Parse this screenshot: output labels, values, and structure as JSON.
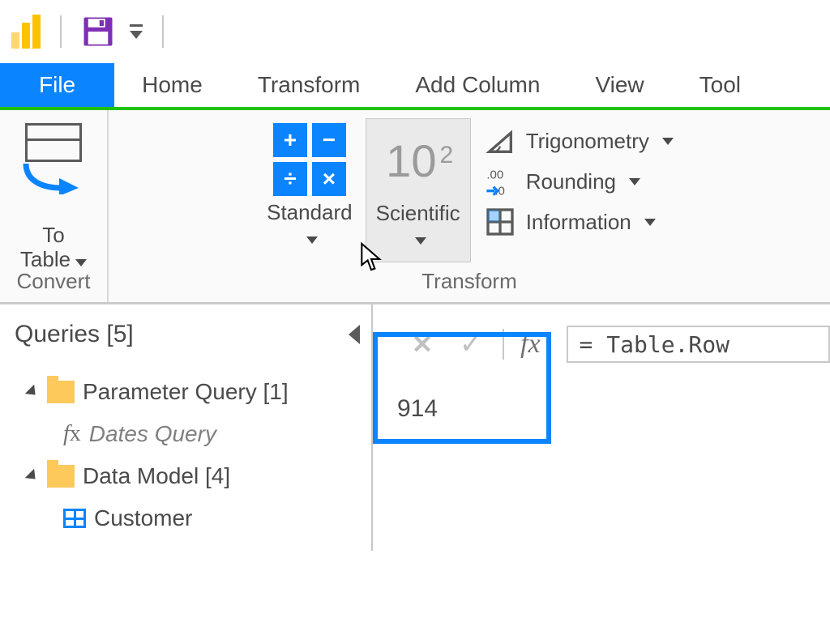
{
  "tabs": {
    "file": "File",
    "home": "Home",
    "transform": "Transform",
    "add_column": "Add Column",
    "view": "View",
    "tools": "Tool"
  },
  "ribbon": {
    "convert": {
      "to_table": "To\nTable",
      "group_label": "Convert"
    },
    "transform": {
      "standard": "Standard",
      "scientific": "Scientific",
      "trigonometry": "Trigonometry",
      "rounding": "Rounding",
      "information": "Information",
      "group_label": "Transform"
    }
  },
  "queries": {
    "header": "Queries [5]",
    "items": {
      "parameter_group": "Parameter Query [1]",
      "dates_query": "Dates Query",
      "data_model_group": "Data Model [4]",
      "customer": "Customer"
    }
  },
  "formula_bar": {
    "fx_label": "fx",
    "formula": "= Table.Row"
  },
  "result_value": "914"
}
